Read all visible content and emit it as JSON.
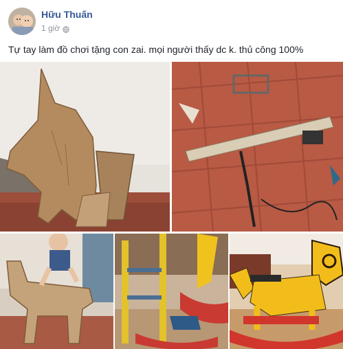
{
  "post": {
    "author": "Hữu Thuấn",
    "time": "1 giờ",
    "text": "Tự tay làm đồ chơi tặng con zai. mọi người thấy dc k. thủ công 100%"
  },
  "photos": [
    {
      "icon": "wooden-horse-cutout-photo"
    },
    {
      "icon": "workshop-tools-photo"
    },
    {
      "icon": "baby-on-wooden-horse-photo"
    },
    {
      "icon": "rocking-horse-frame-photo"
    },
    {
      "icon": "painted-rocking-horse-photo"
    }
  ],
  "colors": {
    "author_link": "#365899",
    "meta": "#90949c",
    "text": "#1d2129"
  }
}
